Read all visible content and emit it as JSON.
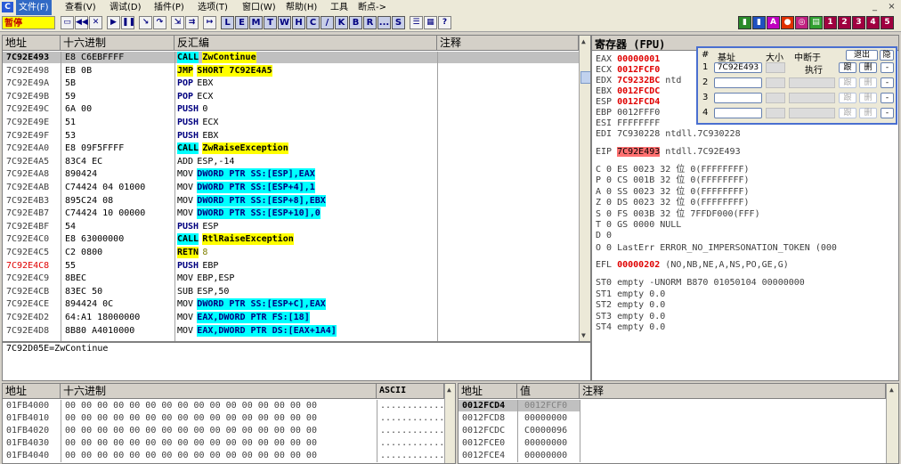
{
  "menubar": {
    "logo": "C",
    "items": [
      "文件(F)",
      "查看(V)",
      "调试(D)",
      "插件(P)",
      "选项(T)",
      "窗口(W)",
      "帮助(H)",
      "工具",
      "断点->"
    ],
    "win_controls": [
      "_",
      "×"
    ]
  },
  "toolbar": {
    "status": "暂停",
    "letters": [
      "L",
      "E",
      "M",
      "T",
      "W",
      "H",
      "C",
      "/",
      "K",
      "B",
      "R",
      "...",
      "S"
    ],
    "right_icons": [
      "1",
      "2",
      "3",
      "4",
      "5"
    ]
  },
  "disasm": {
    "headers": [
      "地址",
      "十六进制",
      "反汇编",
      "注释"
    ],
    "rows": [
      {
        "addr": "7C92E493",
        "hex": "E8 C6EBFFFF",
        "op": "CALL",
        "arg": "ZwContinue"
      },
      {
        "addr": "7C92E498",
        "hex": "EB 0B",
        "op": "JMP",
        "arg": "SHORT 7C92E4A5"
      },
      {
        "addr": "7C92E49A",
        "hex": "5B",
        "op": "POP",
        "arg": "EBX"
      },
      {
        "addr": "7C92E49B",
        "hex": "59",
        "op": "POP",
        "arg": "ECX"
      },
      {
        "addr": "7C92E49C",
        "hex": "6A 00",
        "op": "PUSH",
        "arg": "0"
      },
      {
        "addr": "7C92E49E",
        "hex": "51",
        "op": "PUSH",
        "arg": "ECX"
      },
      {
        "addr": "7C92E49F",
        "hex": "53",
        "op": "PUSH",
        "arg": "EBX"
      },
      {
        "addr": "7C92E4A0",
        "hex": "E8 09F5FFFF",
        "op": "CALL",
        "arg": "ZwRaiseException"
      },
      {
        "addr": "7C92E4A5",
        "hex": "83C4 EC",
        "op": "ADD",
        "arg": "ESP,-14"
      },
      {
        "addr": "7C92E4A8",
        "hex": "890424",
        "op": "MOV",
        "arg": "DWORD PTR SS:[ESP],EAX"
      },
      {
        "addr": "7C92E4AB",
        "hex": "C74424 04 01000",
        "op": "MOV",
        "arg": "DWORD PTR SS:[ESP+4],1"
      },
      {
        "addr": "7C92E4B3",
        "hex": "895C24 08",
        "op": "MOV",
        "arg": "DWORD PTR SS:[ESP+8],EBX"
      },
      {
        "addr": "7C92E4B7",
        "hex": "C74424 10 00000",
        "op": "MOV",
        "arg": "DWORD PTR SS:[ESP+10],0"
      },
      {
        "addr": "7C92E4BF",
        "hex": "54",
        "op": "PUSH",
        "arg": "ESP"
      },
      {
        "addr": "7C92E4C0",
        "hex": "E8 63000000",
        "op": "CALL",
        "arg": "RtlRaiseException"
      },
      {
        "addr": "7C92E4C5",
        "hex": "C2 0800",
        "op": "RETN",
        "arg": "8"
      },
      {
        "addr": "7C92E4C8",
        "hex": "55",
        "op": "PUSH",
        "arg": "EBP"
      },
      {
        "addr": "7C92E4C9",
        "hex": "8BEC",
        "op": "MOV",
        "arg": "EBP,ESP"
      },
      {
        "addr": "7C92E4CB",
        "hex": "83EC 50",
        "op": "SUB",
        "arg": "ESP,50"
      },
      {
        "addr": "7C92E4CE",
        "hex": "894424 0C",
        "op": "MOV",
        "arg": "DWORD PTR SS:[ESP+C],EAX"
      },
      {
        "addr": "7C92E4D2",
        "hex": "64:A1 18000000",
        "op": "MOV",
        "arg": "EAX,DWORD PTR FS:[18]"
      },
      {
        "addr": "7C92E4D8",
        "hex": "8B80 A4010000",
        "op": "MOV",
        "arg": "EAX,DWORD PTR DS:[EAX+1A4]"
      }
    ]
  },
  "info_line": "7C92D05E=ZwContinue",
  "registers": {
    "title": "寄存器 (FPU)",
    "gp": [
      {
        "name": "EAX",
        "val": "00000001",
        "note": "",
        "hl": true
      },
      {
        "name": "ECX",
        "val": "0012FCF0",
        "note": "",
        "hl": true
      },
      {
        "name": "EDX",
        "val": "7C9232BC",
        "note": "ntd",
        "hl": true
      },
      {
        "name": "EBX",
        "val": "0012FCDC",
        "note": "",
        "hl": true
      },
      {
        "name": "ESP",
        "val": "0012FCD4",
        "note": "",
        "hl": true
      },
      {
        "name": "EBP",
        "val": "0012FFF0",
        "note": "",
        "hl": false
      },
      {
        "name": "ESI",
        "val": "FFFFFFFF",
        "note": "",
        "hl": false
      },
      {
        "name": "EDI",
        "val": "7C930228",
        "note": "ntdll.7C930228",
        "hl": false
      }
    ],
    "eip": {
      "name": "EIP",
      "val": "7C92E493",
      "note": "ntdll.7C92E493"
    },
    "flags": [
      "C 0   ES 0023 32 位 0(FFFFFFFF)",
      "P 0   CS 001B 32 位 0(FFFFFFFF)",
      "A 0   SS 0023 32 位 0(FFFFFFFF)",
      "Z 0   DS 0023 32 位 0(FFFFFFFF)",
      "S 0   FS 003B 32 位 7FFDF000(FFF)",
      "T 0   GS 0000 NULL",
      "D 0",
      "O 0   LastErr ERROR_NO_IMPERSONATION_TOKEN (000"
    ],
    "efl": {
      "name": "EFL",
      "val": "00000202",
      "note": "(NO,NB,NE,A,NS,PO,GE,G)"
    },
    "fpu": [
      "ST0 empty -UNORM B870 01050104 00000000",
      "ST1 empty 0.0",
      "ST2 empty 0.0",
      "ST3 empty 0.0",
      "ST4 empty 0.0"
    ]
  },
  "dump": {
    "headers": [
      "地址",
      "十六进制",
      "ASCII"
    ],
    "rows": [
      {
        "addr": "01FB4000",
        "hex": "00 00 00 00 00 00 00 00 00 00 00 00 00 00 00 00",
        "ascii": "................"
      },
      {
        "addr": "01FB4010",
        "hex": "00 00 00 00 00 00 00 00 00 00 00 00 00 00 00 00",
        "ascii": "................"
      },
      {
        "addr": "01FB4020",
        "hex": "00 00 00 00 00 00 00 00 00 00 00 00 00 00 00 00",
        "ascii": "................"
      },
      {
        "addr": "01FB4030",
        "hex": "00 00 00 00 00 00 00 00 00 00 00 00 00 00 00 00",
        "ascii": "................"
      },
      {
        "addr": "01FB4040",
        "hex": "00 00 00 00 00 00 00 00 00 00 00 00 00 00 00 00",
        "ascii": "................"
      }
    ]
  },
  "stack": {
    "headers": [
      "地址",
      "值",
      "注释"
    ],
    "rows": [
      {
        "addr": "0012FCD4",
        "val": "0012FCF0"
      },
      {
        "addr": "0012FCD8",
        "val": "00000000"
      },
      {
        "addr": "0012FCDC",
        "val": "C0000096"
      },
      {
        "addr": "0012FCE0",
        "val": "00000000"
      },
      {
        "addr": "0012FCE4",
        "val": "00000000"
      }
    ]
  },
  "bp_window": {
    "headers": [
      "#",
      "基址",
      "大小",
      "中断于"
    ],
    "exit_label": "退出",
    "hide_label": "隐",
    "rows": [
      {
        "num": "1",
        "addr": "7C92E493",
        "mode": "执行",
        "follow": "跟",
        "del": "删",
        "dash": "-",
        "enabled": true
      },
      {
        "num": "2",
        "addr": "",
        "mode": "",
        "follow": "跟",
        "del": "删",
        "dash": "-",
        "enabled": false
      },
      {
        "num": "3",
        "addr": "",
        "mode": "",
        "follow": "跟",
        "del": "删",
        "dash": "-",
        "enabled": false
      },
      {
        "num": "4",
        "addr": "",
        "mode": "",
        "follow": "跟",
        "del": "删",
        "dash": "-",
        "enabled": false
      }
    ]
  }
}
